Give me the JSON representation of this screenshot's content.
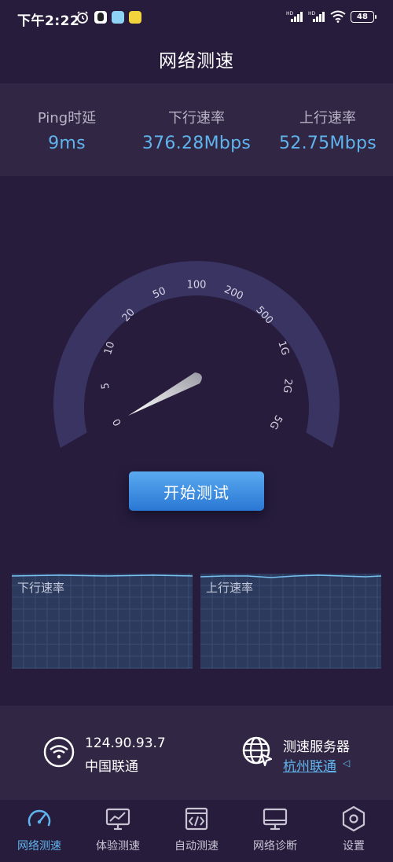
{
  "status_bar": {
    "time": "下午2:22",
    "battery": "48"
  },
  "header": {
    "title": "网络测速"
  },
  "stats": {
    "ping": {
      "label": "Ping时延",
      "value": "9ms"
    },
    "download": {
      "label": "下行速率",
      "value": "376.28Mbps"
    },
    "upload": {
      "label": "上行速率",
      "value": "52.75Mbps"
    }
  },
  "gauge": {
    "ticks": [
      "0",
      "5",
      "10",
      "20",
      "50",
      "100",
      "200",
      "500",
      "1G",
      "2G",
      "5G"
    ],
    "needle_value": "0"
  },
  "start_button": {
    "label": "开始测试"
  },
  "charts": {
    "download_label": "下行速率",
    "upload_label": "上行速率"
  },
  "network": {
    "ip": "124.90.93.7",
    "isp": "中国联通",
    "server_title": "测速服务器",
    "server_name": "杭州联通"
  },
  "tabs": [
    {
      "label": "网络测速",
      "icon": "gauge-icon",
      "active": true
    },
    {
      "label": "体验测速",
      "icon": "monitor-chart-icon",
      "active": false
    },
    {
      "label": "自动测速",
      "icon": "code-window-icon",
      "active": false
    },
    {
      "label": "网络诊断",
      "icon": "computer-icon",
      "active": false
    },
    {
      "label": "设置",
      "icon": "settings-hexagon-icon",
      "active": false
    }
  ],
  "colors": {
    "background": "#271c3c",
    "panel": "#312744",
    "accent": "#5fb4ee",
    "chart_bg": "#2b3a5d"
  }
}
